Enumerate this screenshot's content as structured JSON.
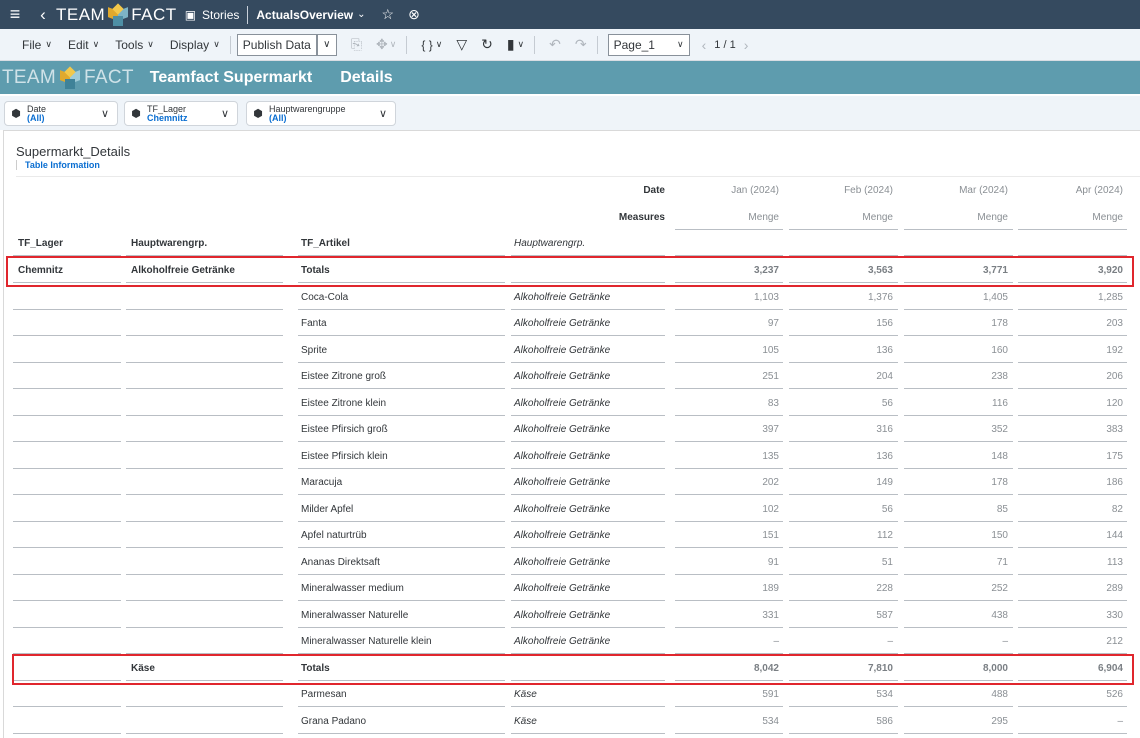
{
  "shell": {
    "logo_team": "TEAM",
    "logo_fact": "FACT",
    "stories_label": "Stories",
    "story_title": "ActualsOverview"
  },
  "toolbar": {
    "file": "File",
    "edit": "Edit",
    "tools": "Tools",
    "display": "Display",
    "publish": "Publish Data",
    "braces": "{ }",
    "page_select": "Page_1",
    "page_count": "1 / 1"
  },
  "header": {
    "logo_team": "TEAM",
    "logo_fact": "FACT",
    "title": "Teamfact Supermarkt",
    "subtitle": "Details"
  },
  "filters": [
    {
      "label": "Date",
      "value": "(All)"
    },
    {
      "label": "TF_Lager",
      "value": "Chemnitz"
    },
    {
      "label": "Hauptwarengruppe",
      "value": "(All)"
    }
  ],
  "table": {
    "title": "Supermarkt_Details",
    "subtitle": "Table Information",
    "date_label": "Date",
    "measures_label": "Measures",
    "months": [
      "Jan (2024)",
      "Feb (2024)",
      "Mar (2024)",
      "Apr (2024)"
    ],
    "measure": "Menge",
    "headers": [
      "TF_Lager",
      "Hauptwarengrp.",
      "TF_Artikel",
      "Hauptwarengrp."
    ],
    "rows": [
      {
        "lager": "Chemnitz",
        "gruppe": "Alkoholfreie Getränke",
        "artikel": "Totals",
        "grp": "",
        "v": [
          "3,237",
          "3,563",
          "3,771",
          "3,920"
        ],
        "total": true
      },
      {
        "lager": "",
        "gruppe": "",
        "artikel": "Coca-Cola",
        "grp": "Alkoholfreie Getränke",
        "v": [
          "1,103",
          "1,376",
          "1,405",
          "1,285"
        ]
      },
      {
        "lager": "",
        "gruppe": "",
        "artikel": "Fanta",
        "grp": "Alkoholfreie Getränke",
        "v": [
          "97",
          "156",
          "178",
          "203"
        ]
      },
      {
        "lager": "",
        "gruppe": "",
        "artikel": "Sprite",
        "grp": "Alkoholfreie Getränke",
        "v": [
          "105",
          "136",
          "160",
          "192"
        ]
      },
      {
        "lager": "",
        "gruppe": "",
        "artikel": "Eistee Zitrone groß",
        "grp": "Alkoholfreie Getränke",
        "v": [
          "251",
          "204",
          "238",
          "206"
        ]
      },
      {
        "lager": "",
        "gruppe": "",
        "artikel": "Eistee Zitrone klein",
        "grp": "Alkoholfreie Getränke",
        "v": [
          "83",
          "56",
          "116",
          "120"
        ]
      },
      {
        "lager": "",
        "gruppe": "",
        "artikel": "Eistee Pfirsich groß",
        "grp": "Alkoholfreie Getränke",
        "v": [
          "397",
          "316",
          "352",
          "383"
        ]
      },
      {
        "lager": "",
        "gruppe": "",
        "artikel": "Eistee Pfirsich klein",
        "grp": "Alkoholfreie Getränke",
        "v": [
          "135",
          "136",
          "148",
          "175"
        ]
      },
      {
        "lager": "",
        "gruppe": "",
        "artikel": "Maracuja",
        "grp": "Alkoholfreie Getränke",
        "v": [
          "202",
          "149",
          "178",
          "186"
        ]
      },
      {
        "lager": "",
        "gruppe": "",
        "artikel": "Milder Apfel",
        "grp": "Alkoholfreie Getränke",
        "v": [
          "102",
          "56",
          "85",
          "82"
        ]
      },
      {
        "lager": "",
        "gruppe": "",
        "artikel": "Apfel naturtrüb",
        "grp": "Alkoholfreie Getränke",
        "v": [
          "151",
          "112",
          "150",
          "144"
        ]
      },
      {
        "lager": "",
        "gruppe": "",
        "artikel": "Ananas Direktsaft",
        "grp": "Alkoholfreie Getränke",
        "v": [
          "91",
          "51",
          "71",
          "113"
        ]
      },
      {
        "lager": "",
        "gruppe": "",
        "artikel": "Mineralwasser medium",
        "grp": "Alkoholfreie Getränke",
        "v": [
          "189",
          "228",
          "252",
          "289"
        ]
      },
      {
        "lager": "",
        "gruppe": "",
        "artikel": "Mineralwasser Naturelle",
        "grp": "Alkoholfreie Getränke",
        "v": [
          "331",
          "587",
          "438",
          "330"
        ]
      },
      {
        "lager": "",
        "gruppe": "",
        "artikel": "Mineralwasser Naturelle klein",
        "grp": "Alkoholfreie Getränke",
        "v": [
          "–",
          "–",
          "–",
          "212"
        ]
      },
      {
        "lager": "",
        "gruppe": "Käse",
        "artikel": "Totals",
        "grp": "",
        "v": [
          "8,042",
          "7,810",
          "8,000",
          "6,904"
        ],
        "total": true
      },
      {
        "lager": "",
        "gruppe": "",
        "artikel": "Parmesan",
        "grp": "Käse",
        "v": [
          "591",
          "534",
          "488",
          "526"
        ]
      },
      {
        "lager": "",
        "gruppe": "",
        "artikel": "Grana Padano",
        "grp": "Käse",
        "v": [
          "534",
          "586",
          "295",
          "–"
        ]
      }
    ]
  }
}
